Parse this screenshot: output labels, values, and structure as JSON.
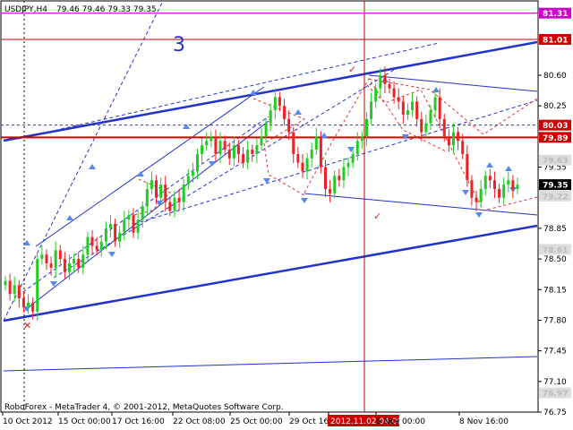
{
  "header": {
    "symbol": "USDJPY,H4",
    "ohlc": "79.46 79.46 79.33 79.35"
  },
  "footer": {
    "copyright": "RoboForex - MetaTrader 4, © 2001-2012, MetaQuotes Software Corp."
  },
  "annotations": {
    "wave_label": "3"
  },
  "colors": {
    "background": "#ffffff",
    "bull_candle": "#22cc22",
    "bear_candle": "#ee2222",
    "trendline": "#2233cc",
    "level_line": "#cc0000",
    "target_line": "#cc00cc",
    "axis_text": "#000000",
    "marker": "#5588ee"
  },
  "chart_data": {
    "type": "candlestick",
    "symbol": "USDJPY",
    "timeframe": "H4",
    "ylim": [
      76.75,
      81.45
    ],
    "x_labels": [
      "10 Oct 2012",
      "15 Oct 00:00",
      "17 Oct 16:00",
      "22 Oct 08:00",
      "25 Oct 00:00",
      "29 Oct 16:00",
      "2012.11.02 04:00",
      "6 Nov 00:00",
      "8 Nov 16:00"
    ],
    "y_ticks": [
      81.01,
      80.6,
      80.25,
      79.9,
      79.55,
      79.2,
      78.85,
      78.5,
      78.15,
      77.8,
      77.45,
      77.1,
      76.75
    ],
    "price_tags": [
      {
        "value": 81.31,
        "label": "81.31",
        "kind": "target"
      },
      {
        "value": 81.01,
        "label": "81.01",
        "kind": "level"
      },
      {
        "value": 80.03,
        "label": "80.03",
        "kind": "level"
      },
      {
        "value": 79.89,
        "label": "79.89",
        "kind": "level"
      },
      {
        "value": 79.63,
        "label": "79.63",
        "kind": "faded"
      },
      {
        "value": 79.35,
        "label": "79.35",
        "kind": "current"
      },
      {
        "value": 79.22,
        "label": "79.22",
        "kind": "faded"
      },
      {
        "value": 78.61,
        "label": "78.61",
        "kind": "faded"
      },
      {
        "value": 76.97,
        "label": "76.97",
        "kind": "faded"
      }
    ],
    "close_series": [
      78.25,
      78.1,
      78.2,
      78.05,
      77.95,
      78.0,
      77.9,
      78.5,
      78.55,
      78.45,
      78.4,
      78.6,
      78.5,
      78.35,
      78.45,
      78.5,
      78.4,
      78.55,
      78.75,
      78.65,
      78.6,
      78.7,
      78.85,
      78.9,
      78.7,
      78.8,
      78.95,
      79.0,
      78.8,
      78.95,
      79.1,
      79.3,
      79.4,
      79.2,
      79.35,
      79.15,
      79.05,
      79.2,
      79.15,
      79.35,
      79.45,
      79.5,
      79.7,
      79.8,
      79.85,
      79.9,
      79.7,
      79.85,
      79.75,
      79.65,
      79.8,
      79.7,
      79.6,
      79.75,
      79.7,
      79.8,
      79.9,
      80.05,
      80.2,
      80.35,
      80.25,
      80.1,
      79.95,
      79.7,
      79.6,
      79.5,
      79.65,
      79.75,
      79.9,
      79.55,
      79.3,
      79.25,
      79.45,
      79.4,
      79.55,
      79.6,
      79.7,
      79.85,
      79.9,
      80.1,
      80.3,
      80.45,
      80.6,
      80.5,
      80.45,
      80.35,
      80.3,
      80.15,
      80.2,
      80.3,
      80.1,
      79.95,
      80.05,
      80.2,
      80.35,
      80.1,
      79.9,
      79.8,
      79.95,
      79.85,
      79.7,
      79.4,
      79.2,
      79.15,
      79.3,
      79.45,
      79.4,
      79.3,
      79.2,
      79.35,
      79.4,
      79.3,
      79.35
    ]
  }
}
